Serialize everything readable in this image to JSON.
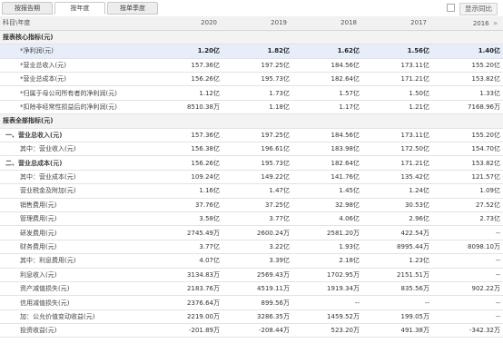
{
  "tabs": [
    {
      "label": "按报告期",
      "active": false
    },
    {
      "label": "按年度",
      "active": true
    },
    {
      "label": "按单季度",
      "active": false
    }
  ],
  "yoy_label": "显示同比",
  "header": {
    "label": "科目\\年度",
    "years": [
      "2020",
      "2019",
      "2018",
      "2017",
      "2016"
    ],
    "more_icon": "»"
  },
  "rows": [
    {
      "label": "报表核心指标(元)",
      "type": "section",
      "values": [
        "",
        "",
        "",
        "",
        ""
      ]
    },
    {
      "label": "*净利润(元)",
      "type": "highlight",
      "values": [
        "1.20亿",
        "1.82亿",
        "1.62亿",
        "1.56亿",
        "1.40亿"
      ]
    },
    {
      "label": "*营业总收入(元)",
      "type": "indent2",
      "values": [
        "157.36亿",
        "197.25亿",
        "184.56亿",
        "173.11亿",
        "155.20亿"
      ]
    },
    {
      "label": "*营业总成本(元)",
      "type": "indent2",
      "values": [
        "156.26亿",
        "195.73亿",
        "182.64亿",
        "171.21亿",
        "153.82亿"
      ]
    },
    {
      "label": "*归属于母公司所有者的净利润(元)",
      "type": "indent2",
      "values": [
        "1.12亿",
        "1.73亿",
        "1.57亿",
        "1.50亿",
        "1.33亿"
      ]
    },
    {
      "label": "*扣除非经常性损益后的净利润(元)",
      "type": "indent2",
      "values": [
        "8510.38万",
        "1.18亿",
        "1.17亿",
        "1.21亿",
        "7168.96万"
      ]
    },
    {
      "label": "报表全部指标(元)",
      "type": "section",
      "values": [
        "",
        "",
        "",
        "",
        ""
      ]
    },
    {
      "label": "一、营业总收入(元)",
      "type": "bold1",
      "values": [
        "157.36亿",
        "197.25亿",
        "184.56亿",
        "173.11亿",
        "155.20亿"
      ]
    },
    {
      "label": "其中：营业收入(元)",
      "type": "indent2",
      "values": [
        "156.38亿",
        "196.61亿",
        "183.98亿",
        "172.50亿",
        "154.70亿"
      ]
    },
    {
      "label": "二、营业总成本(元)",
      "type": "bold1",
      "values": [
        "156.26亿",
        "195.73亿",
        "182.64亿",
        "171.21亿",
        "153.82亿"
      ]
    },
    {
      "label": "其中：营业成本(元)",
      "type": "indent2",
      "values": [
        "109.24亿",
        "149.22亿",
        "141.76亿",
        "135.42亿",
        "121.57亿"
      ]
    },
    {
      "label": "营业税金及附加(元)",
      "type": "indent2",
      "values": [
        "1.16亿",
        "1.47亿",
        "1.45亿",
        "1.24亿",
        "1.09亿"
      ]
    },
    {
      "label": "销售费用(元)",
      "type": "indent2",
      "values": [
        "37.76亿",
        "37.25亿",
        "32.98亿",
        "30.53亿",
        "27.52亿"
      ]
    },
    {
      "label": "管理费用(元)",
      "type": "indent2",
      "values": [
        "3.58亿",
        "3.77亿",
        "4.06亿",
        "2.96亿",
        "2.73亿"
      ]
    },
    {
      "label": "研发费用(元)",
      "type": "indent2",
      "values": [
        "2745.49万",
        "2600.24万",
        "2581.20万",
        "422.54万",
        "--"
      ]
    },
    {
      "label": "财务费用(元)",
      "type": "indent2",
      "values": [
        "3.77亿",
        "3.22亿",
        "1.93亿",
        "8995.44万",
        "8098.10万"
      ]
    },
    {
      "label": "其中：利息费用(元)",
      "type": "indent2",
      "values": [
        "4.07亿",
        "3.39亿",
        "2.18亿",
        "1.23亿",
        "--"
      ]
    },
    {
      "label": "利息收入(元)",
      "type": "indent2",
      "values": [
        "3134.83万",
        "2569.43万",
        "1702.95万",
        "2151.51万",
        "--"
      ]
    },
    {
      "label": "资产减值损失(元)",
      "type": "indent2",
      "values": [
        "2183.76万",
        "4519.11万",
        "1919.34万",
        "835.56万",
        "902.22万"
      ]
    },
    {
      "label": "信用减值损失(元)",
      "type": "indent2",
      "values": [
        "2376.64万",
        "899.56万",
        "--",
        "--",
        "--"
      ]
    },
    {
      "label": "加：公允价值变动收益(元)",
      "type": "indent2",
      "values": [
        "2219.00万",
        "3286.35万",
        "1459.52万",
        "199.05万",
        "--"
      ]
    },
    {
      "label": "投资收益(元)",
      "type": "indent2",
      "values": [
        "-201.89万",
        "-208.44万",
        "523.20万",
        "491.38万",
        "-342.32万"
      ]
    }
  ]
}
